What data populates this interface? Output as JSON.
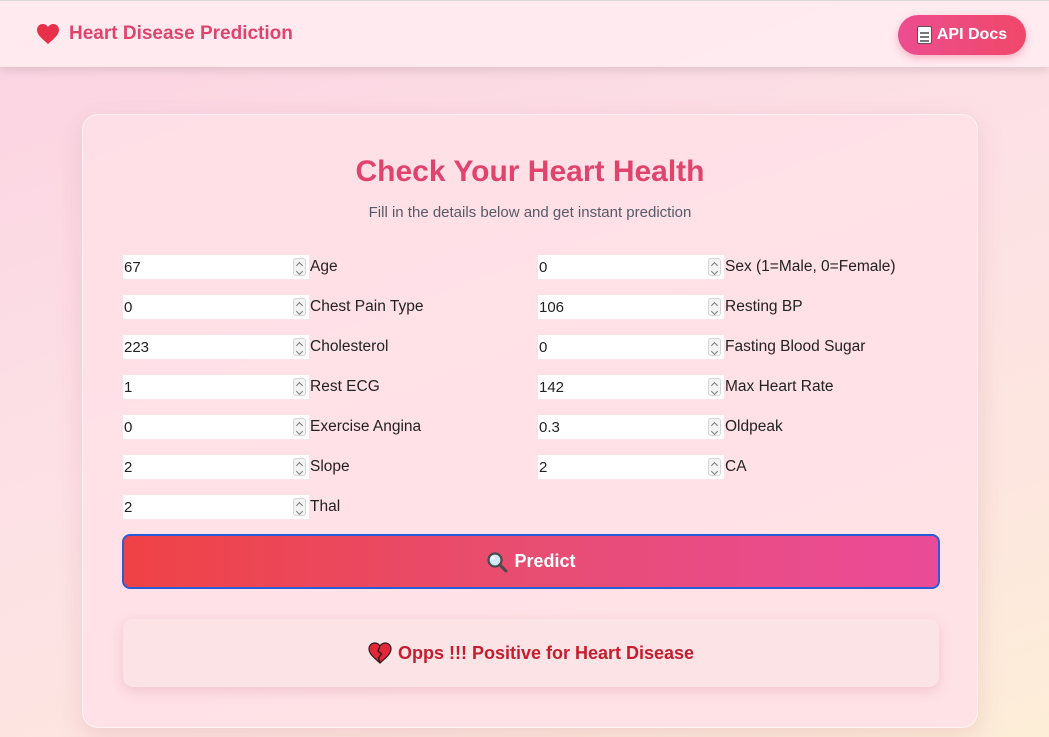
{
  "header": {
    "title": "Heart Disease Prediction",
    "logo_icon": "heart-icon",
    "api_docs_label": "API Docs",
    "api_docs_icon": "document-icon"
  },
  "card": {
    "title": "Check Your Heart Health",
    "subtitle": "Fill in the details below and get instant prediction"
  },
  "fields": [
    {
      "label": "Age",
      "value": "67"
    },
    {
      "label": "Sex (1=Male, 0=Female)",
      "value": "0"
    },
    {
      "label": "Chest Pain Type",
      "value": "0"
    },
    {
      "label": "Resting BP",
      "value": "106"
    },
    {
      "label": "Cholesterol",
      "value": "223"
    },
    {
      "label": "Fasting Blood Sugar",
      "value": "0"
    },
    {
      "label": "Rest ECG",
      "value": "1"
    },
    {
      "label": "Max Heart Rate",
      "value": "142"
    },
    {
      "label": "Exercise Angina",
      "value": "0"
    },
    {
      "label": "Oldpeak",
      "value": "0.3"
    },
    {
      "label": "Slope",
      "value": "2"
    },
    {
      "label": "CA",
      "value": "2"
    },
    {
      "label": "Thal",
      "value": "2"
    }
  ],
  "predict_button": {
    "label": "Predict",
    "icon": "magnifier-icon"
  },
  "result": {
    "text": "Opps !!! Positive for Heart Disease",
    "icon": "broken-heart-icon"
  },
  "colors": {
    "accent": "#e0446c",
    "button_gradient_start": "#ef4245",
    "button_gradient_end": "#ea4b98",
    "result_text": "#c51d2d"
  }
}
